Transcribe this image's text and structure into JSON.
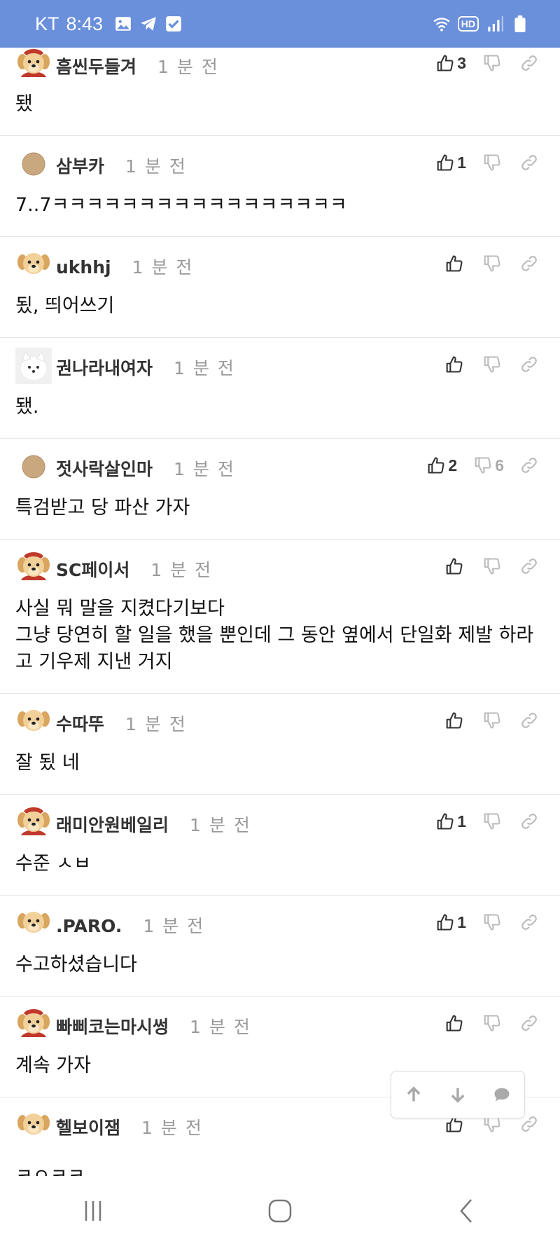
{
  "status_bar": {
    "carrier": "KT",
    "time": "8:43",
    "hd_label": "HD"
  },
  "comments": [
    {
      "user": "흠씬두들겨",
      "time": "1 분 전",
      "body": "됐",
      "up": "3",
      "down": "",
      "avatar": "puppy-red"
    },
    {
      "user": "삼부카",
      "time": "1 분 전",
      "body": "7..7ㅋㅋㅋㅋㅋㅋㅋㅋㅋㅋㅋㅋㅋㅋㅋㅋㅋ",
      "up": "1",
      "down": "",
      "avatar": "circle-tan"
    },
    {
      "user": "ukhhj",
      "time": "1 분 전",
      "body": "됬, 띄어쓰기",
      "up": "",
      "down": "",
      "avatar": "puppy"
    },
    {
      "user": "권나라내여자",
      "time": "1 분 전",
      "body": "됐.",
      "up": "",
      "down": "",
      "avatar": "white-fox"
    },
    {
      "user": "젓사락살인마",
      "time": "1 분 전",
      "body": "특검받고 당 파산 가자",
      "up": "2",
      "down": "6",
      "avatar": "circle-tan"
    },
    {
      "user": "SC페이서",
      "time": "1 분 전",
      "body": "사실 뭐 말을 지켰다기보다\n그냥 당연히 할 일을 했을 뿐인데 그 동안 옆에서 단일화 제발 하라\n고 기우제 지낸 거지",
      "up": "",
      "down": "",
      "avatar": "puppy-red"
    },
    {
      "user": "수따뚜",
      "time": "1 분 전",
      "body": "잘 됬 네",
      "up": "",
      "down": "",
      "avatar": "puppy"
    },
    {
      "user": "래미안원베일리",
      "time": "1 분 전",
      "body": "수준 ㅅㅂ",
      "up": "1",
      "down": "",
      "avatar": "puppy-red"
    },
    {
      "user": ".PARO.",
      "time": "1 분 전",
      "body": "수고하셨습니다",
      "up": "1",
      "down": "",
      "avatar": "puppy"
    },
    {
      "user": "빠삐코는마시썽",
      "time": "1 분 전",
      "body": "계속 가자",
      "up": "",
      "down": "",
      "avatar": "puppy-red"
    },
    {
      "user": "헬보이잼",
      "time": "1 분 전",
      "body": "ㅋㅇㅋㅋ",
      "up": "",
      "down": "",
      "avatar": "puppy"
    }
  ],
  "floating_controls": [
    "arrow-up-icon",
    "arrow-down-icon",
    "comment-bubble-icon"
  ],
  "nav_bar": [
    "recent-apps-icon",
    "home-icon",
    "back-icon"
  ],
  "colors": {
    "status_bar": "#6a8fdb",
    "divider": "#e6e6e6",
    "muted_text": "#9a9a9a",
    "icon_gray": "#b8b8b8"
  }
}
